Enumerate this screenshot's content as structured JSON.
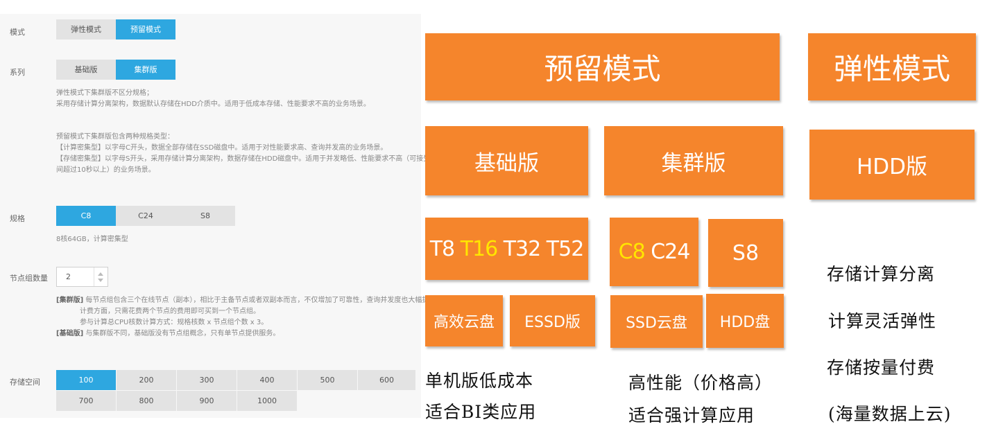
{
  "form": {
    "mode": {
      "label": "模式",
      "options": [
        "弹性模式",
        "预留模式"
      ],
      "selected": 1
    },
    "series": {
      "label": "系列",
      "options": [
        "基础版",
        "集群版"
      ],
      "selected": 1,
      "desc1": [
        "弹性模式下集群版不区分规格；",
        "采用存储计算分离架构，数据默认存储在HDD介质中。适用于低成本存储、性能要求不高的业务场景。"
      ],
      "desc2": [
        "预留模式下集群版包含两种规格类型：",
        "【计算密集型】以字母C开头，数据全部存储在SSD磁盘中。适用于对性能要求高、查询并发高的业务场景。",
        "【存储密集型】以字母S开头，采用存储计算分离架构，数据存储在HDD磁盘中。适用于并发略低、性能要求不高（可接受数据查询响应时",
        "间超过10秒以上）的业务场景。"
      ]
    },
    "spec": {
      "label": "规格",
      "options": [
        "C8",
        "C24",
        "S8"
      ],
      "selected": 0,
      "desc": "8核64GB，计算密集型"
    },
    "nodes": {
      "label": "节点组数量",
      "value": "2",
      "notes": [
        {
          "prefix": "[集群版]",
          "text": " 每节点组包含三个在线节点（副本），相比于主备节点或者双副本而言，不仅增加了可靠性，查询并发度也大幅提升。"
        },
        {
          "prefix": "",
          "text": "计费方面，只需花费两个节点的费用即可买到一个节点组。"
        },
        {
          "prefix": "",
          "text": "参与计算总CPU核数计算方式：规格核数 x 节点组个数 x 3。"
        },
        {
          "prefix": "[基础版]",
          "text": " 与集群版不同，基础版没有节点组概念，只有单节点提供服务。"
        }
      ]
    },
    "storage": {
      "label": "存储空间",
      "options": [
        "100",
        "200",
        "300",
        "400",
        "500",
        "600",
        "700",
        "800",
        "900",
        "1000"
      ],
      "selected": 0
    }
  },
  "diagram": {
    "reserved_title": "预留模式",
    "elastic_title": "弹性模式",
    "basic": "基础版",
    "cluster": "集群版",
    "hdd_edition": "HDD版",
    "basic_specs": [
      "T8",
      "T16",
      "T32",
      "T52"
    ],
    "cluster_c_specs": [
      "C8",
      "C24"
    ],
    "cluster_s_spec": "S8",
    "disk_efficient": "高效云盘",
    "disk_essd": "ESSD版",
    "disk_ssd": "SSD云盘",
    "disk_hdd": "HDD盘",
    "basic_notes": [
      "单机版低成本",
      "适合BI类应用"
    ],
    "cluster_notes": [
      "高性能（价格高）",
      "适合强计算应用"
    ],
    "elastic_notes": [
      "存储计算分离",
      "计算灵活弹性",
      "存储按量付费",
      "(海量数据上云)"
    ],
    "colors": {
      "box": "#f5852c",
      "highlight": "#ffe600",
      "selected_tab": "#2ea7e0"
    }
  }
}
